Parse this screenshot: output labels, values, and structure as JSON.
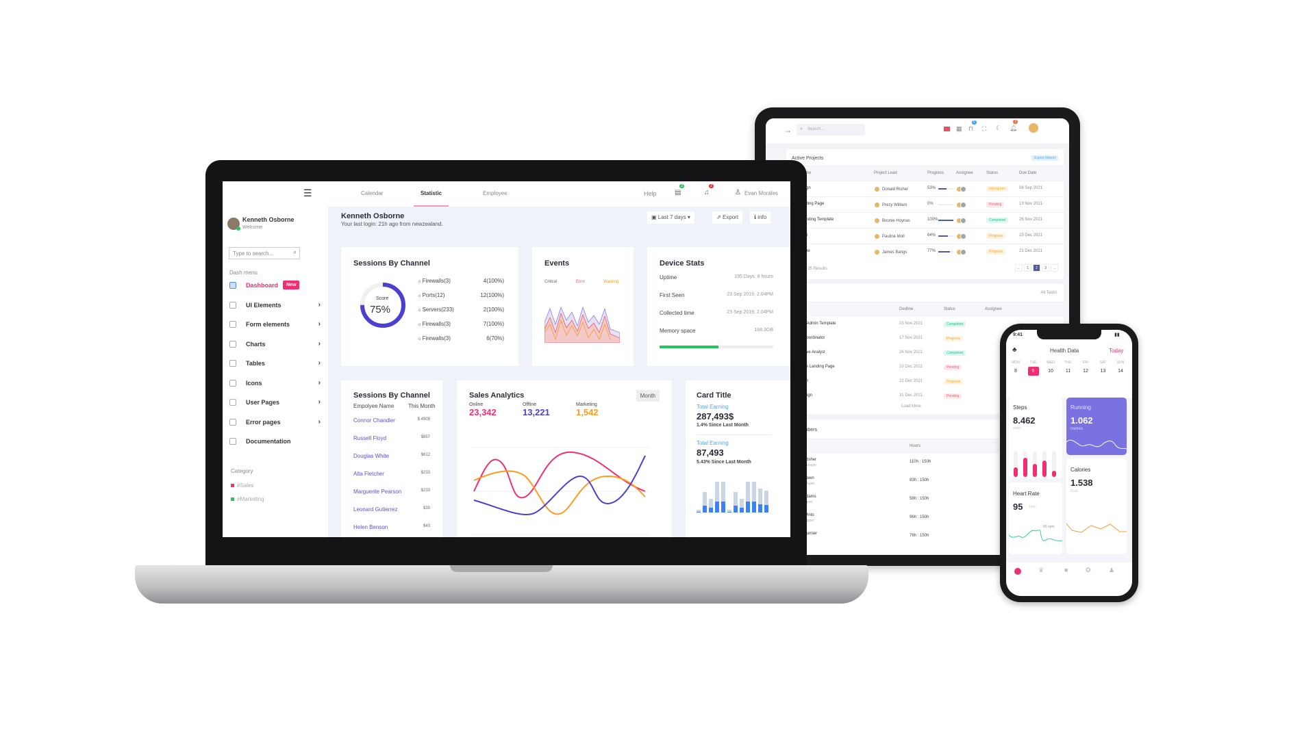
{
  "tablet": {
    "search_placeholder": "Search...",
    "cart_badge": "5",
    "notif_badge": "3",
    "projects": {
      "title": "Active Projects",
      "export": "Export Report",
      "headers": [
        "Project Name",
        "Project Lead",
        "Progress",
        "Assignee",
        "Status",
        "Due Date"
      ],
      "rows": [
        {
          "name": "Logo Design",
          "lead": "Donald Risher",
          "progress": "53%",
          "pct": 53,
          "status": "Inprogress",
          "status_type": "prog",
          "due": "06 Sep 2021"
        },
        {
          "name": "sign - Landing Page",
          "lead": "Prezy William",
          "progress": "0%",
          "pct": 0,
          "status": "Pending",
          "status_type": "pend",
          "due": "13 Nov 2021"
        },
        {
          "name": "urpose Landing Template",
          "lead": "Boonie Hoynas",
          "progress": "100%",
          "pct": 100,
          "status": "Completed",
          "status_type": "comp",
          "due": "26 Nov 2021"
        },
        {
          "name": "Application",
          "lead": "Pauline Moll",
          "progress": "64%",
          "pct": 64,
          "status": "Progress",
          "status_type": "prog",
          "due": "15 Dec 2021"
        },
        {
          "name": "e Wireframe",
          "lead": "James Bangs",
          "progress": "77%",
          "pct": 77,
          "status": "Progress",
          "status_type": "prog",
          "due": "21 Dec 2021"
        }
      ],
      "footer": "ing 5 of 25 Results",
      "pages": [
        "←",
        "1",
        "2",
        "3",
        "→"
      ],
      "active_page": "2"
    },
    "tasks": {
      "title": "asks",
      "filter": "All Tasks",
      "headers": [
        "Dedline",
        "Status",
        "Assignee"
      ],
      "rows": [
        {
          "name": "reate new Admin Template",
          "date": "03 Nov 2021",
          "status": "Completed",
          "status_type": "comp"
        },
        {
          "name": "arketing Coordinator",
          "date": "17 Nov 2021",
          "status": "Progress",
          "status_type": "prog"
        },
        {
          "name": "dministrative Analyst",
          "date": "26 Nov 2021",
          "status": "Completed",
          "status_type": "comp"
        },
        {
          "name": "-commerce Landing Page",
          "date": "10 Dec 2021",
          "status": "Pending",
          "status_type": "pend"
        },
        {
          "name": "/UX Design",
          "date": "22 Dec 2021",
          "status": "Progress",
          "status_type": "prog"
        },
        {
          "name": "ojects Design",
          "date": "31 Dec 2021",
          "status": "Pending",
          "status_type": "pend"
        }
      ],
      "load_more": "Load More"
    },
    "team": {
      "title": "m Members",
      "headers": [
        "ber",
        "Hours"
      ],
      "rows": [
        {
          "name": "Donald Risher",
          "role": "Product Manager",
          "hours": "110h : 150h"
        },
        {
          "name": "Jansh Brown",
          "role": "Lead Developer",
          "hours": "83h : 150h"
        },
        {
          "name": "Carroll Adams",
          "role": "Lead Designer",
          "hours": "58h : 150h"
        },
        {
          "name": "William Pinto",
          "role": "UI/UX Designer",
          "hours": "96h : 150h"
        },
        {
          "name": "Garry Fournier",
          "role": "",
          "hours": "76h : 150h"
        }
      ]
    }
  },
  "laptop": {
    "tabs": [
      "Calendar",
      "Statistic",
      "Employee"
    ],
    "active_tab": "Statistic",
    "help": "Help",
    "msg_badge": "2",
    "notif_badge": "2",
    "user": "Evan Morales",
    "profile": {
      "name": "Kenneth Osborne",
      "sub": "Welcome"
    },
    "search_placeholder": "Type to search...",
    "dash_menu": "Dash menu",
    "menu": [
      {
        "label": "Dashboard",
        "badge": "New"
      },
      {
        "label": "UI Elements"
      },
      {
        "label": "Form elements"
      },
      {
        "label": "Charts"
      },
      {
        "label": "Tables"
      },
      {
        "label": "Icons"
      },
      {
        "label": "User Pages"
      },
      {
        "label": "Error pages"
      },
      {
        "label": "Documentation"
      }
    ],
    "category": "Category",
    "categories": [
      {
        "label": "#Sales",
        "color": "#f0306e"
      },
      {
        "label": "#Marketing",
        "color": "#22c55e"
      }
    ],
    "page_title": "Kenneth Osborne",
    "page_sub": "Your last login: 21h ago from newzealand.",
    "range": "Last 7 days",
    "export": "Export",
    "info": "info",
    "sessions": {
      "title": "Sessions By Channel",
      "score_label": "Score",
      "score": "75%",
      "score_pct": 75,
      "items": [
        {
          "l": "Firewalls(3)",
          "v": "4(100%)"
        },
        {
          "l": "Ports(12)",
          "v": "12(100%)"
        },
        {
          "l": "Servers(233)",
          "v": "2(100%)"
        },
        {
          "l": "Firewalls(3)",
          "v": "7(100%)"
        },
        {
          "l": "Firewalls(3)",
          "v": "6(70%)"
        }
      ]
    },
    "events": {
      "title": "Events",
      "legend": [
        "Critical",
        "Error",
        "Warning"
      ]
    },
    "device": {
      "title": "Device Stats",
      "rows": [
        {
          "k": "Uptime",
          "v": "195 Days, 8 hours"
        },
        {
          "k": "First Seen",
          "v": "23 Sep 2019, 2.04PM"
        },
        {
          "k": "Collected time",
          "v": "23 Sep 2019, 2.04PM"
        },
        {
          "k": "Memory space",
          "v": "168.3GB"
        }
      ],
      "memory_pct": 52
    },
    "sessions2": {
      "title": "Sessions By Channel",
      "col1": "Empolyee Name",
      "col2": "This Month",
      "rows": [
        {
          "n": "Connor Chandler",
          "v": "$ 4909"
        },
        {
          "n": "Russell Floyd",
          "v": "$857"
        },
        {
          "n": "Douglas White",
          "v": "$612"
        },
        {
          "n": "Alta Fletcher",
          "v": "$233"
        },
        {
          "n": "Marguerite Pearson",
          "v": "$233"
        },
        {
          "n": "Leonard Gutierrez",
          "v": "$35"
        },
        {
          "n": "Helen Benson",
          "v": "$43"
        }
      ]
    },
    "sales": {
      "title": "Sales Analytics",
      "period": "Month",
      "stats": [
        {
          "l": "Online",
          "v": "23,342",
          "c": "#f0306e"
        },
        {
          "l": "Offline",
          "v": "13,221",
          "c": "#4b3fcf"
        },
        {
          "l": "Marketing",
          "v": "1,542",
          "c": "#ff9a1f"
        }
      ]
    },
    "cardt": {
      "title": "Card Title",
      "e1_label": "Total Earning",
      "e1": "287,493$",
      "e1_sub": "1.4% Since Last Month",
      "e2_label": "Total Earning",
      "e2": "87,493",
      "e2_sub": "5.43% Since Last Month"
    }
  },
  "phone": {
    "time": "9:41",
    "title": "Health Data",
    "today": "Today",
    "days": [
      {
        "d": "MON",
        "n": "8"
      },
      {
        "d": "TUE",
        "n": "9"
      },
      {
        "d": "WED",
        "n": "10"
      },
      {
        "d": "THU",
        "n": "11"
      },
      {
        "d": "FRI",
        "n": "12"
      },
      {
        "d": "SAT",
        "n": "13"
      },
      {
        "d": "SUN",
        "n": "14"
      }
    ],
    "active_day": "9",
    "steps": {
      "t": "Steps",
      "v": "8.462",
      "u": "steps"
    },
    "running": {
      "t": "Running",
      "v": "1.062",
      "u": "metres"
    },
    "calories": {
      "t": "Calories",
      "v": "1.538",
      "u": "kcal"
    },
    "heart": {
      "t": "Heart Rate",
      "v": "95",
      "u": "bpm",
      "marker": "85 bpm"
    },
    "accent": "#f0306e",
    "running_color": "#7a72e0"
  }
}
